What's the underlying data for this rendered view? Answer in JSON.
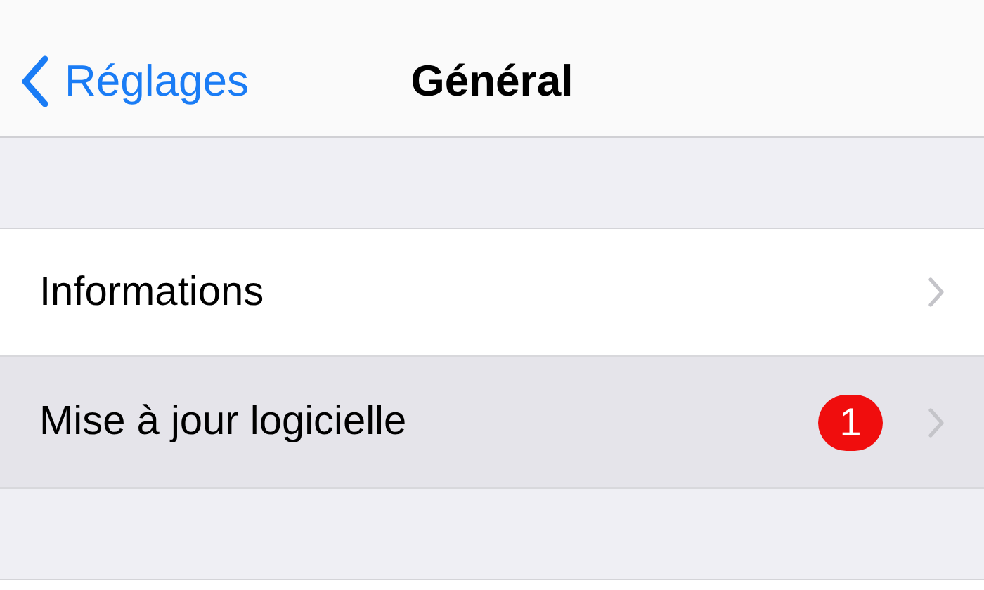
{
  "nav": {
    "back_label": "Réglages",
    "title": "Général"
  },
  "rows": [
    {
      "label": "Informations",
      "selected": false
    },
    {
      "label": "Mise à jour logicielle",
      "selected": true,
      "badge": "1"
    }
  ]
}
